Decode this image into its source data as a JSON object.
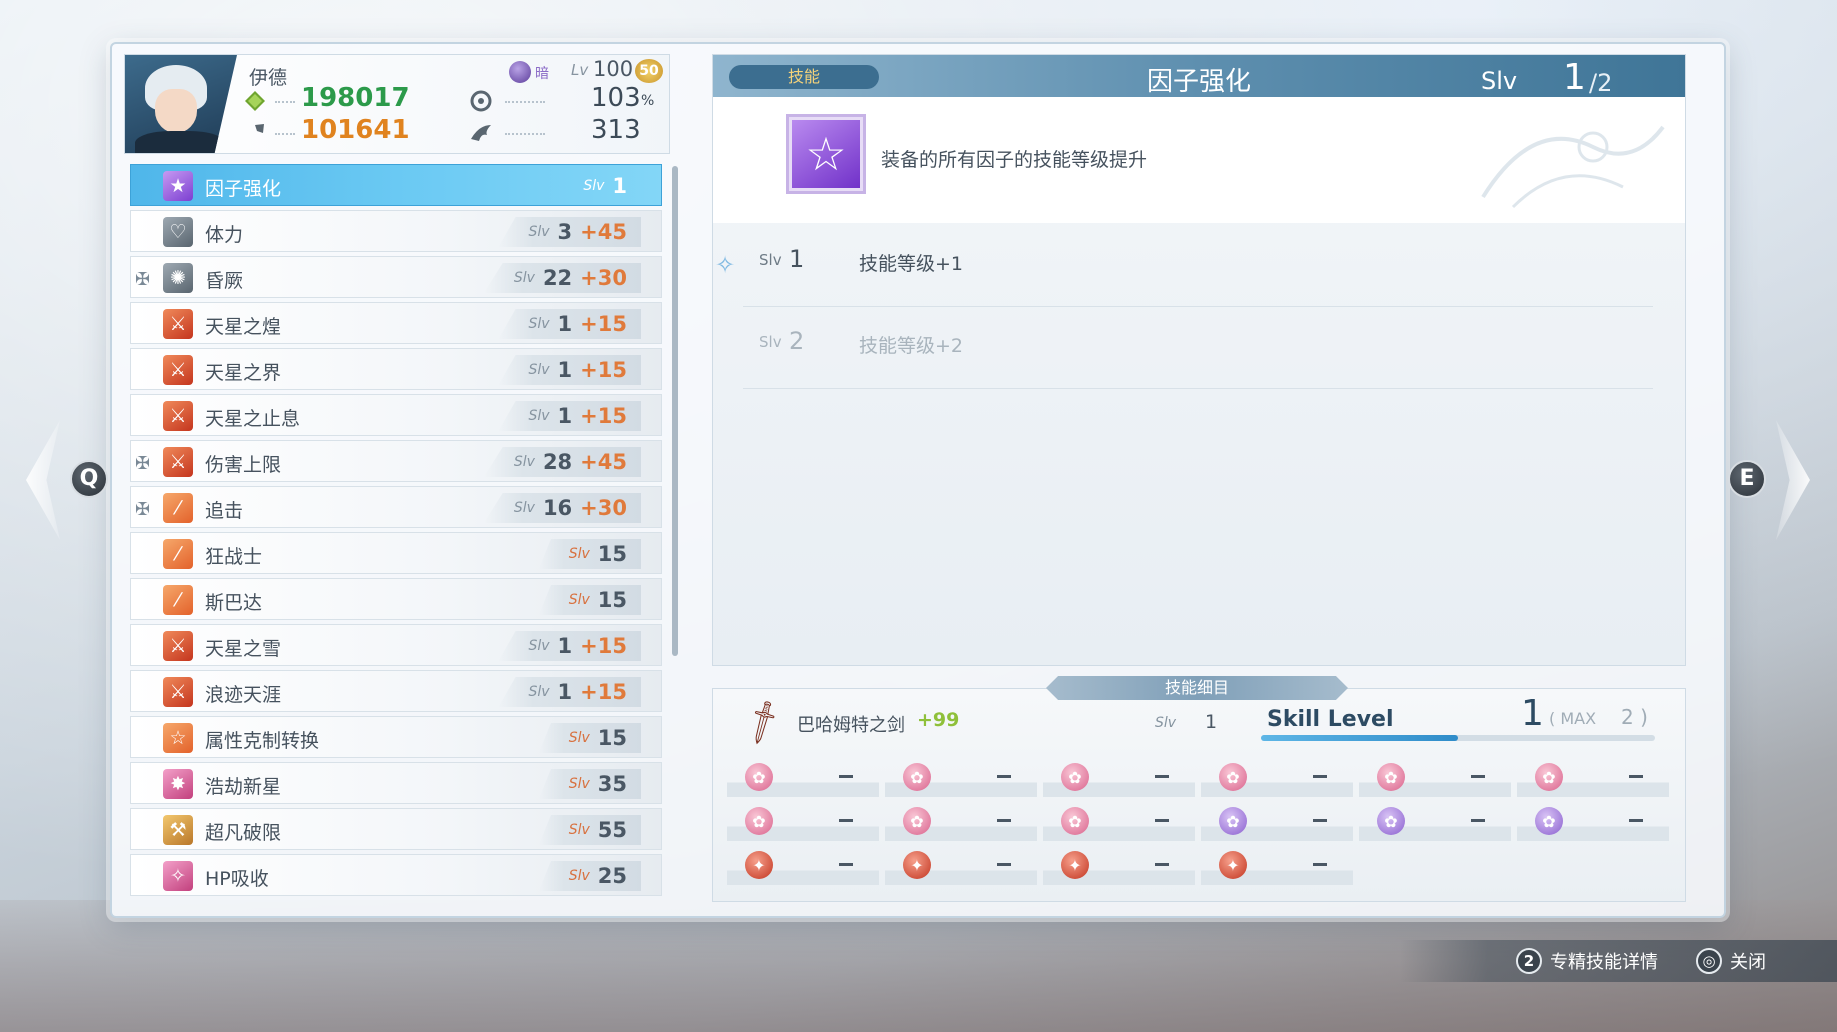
{
  "character": {
    "name": "伊德",
    "element_label": "暗",
    "level_label": "Lv",
    "level": "100",
    "limit_badge": "50",
    "hp": "198017",
    "attack": "101641",
    "crit_pct": "103",
    "crit_pct_unit": "%",
    "stat4": "313"
  },
  "skills": [
    {
      "name": "因子强化",
      "slv_label": "Slv",
      "level": "1",
      "bonus": "",
      "icon": "star-icon",
      "locked": false,
      "selected": true
    },
    {
      "name": "体力",
      "slv_label": "Slv",
      "level": "3",
      "bonus": "+45",
      "icon": "heart-icon",
      "locked": false,
      "selected": false
    },
    {
      "name": "昏厥",
      "slv_label": "Slv",
      "level": "22",
      "bonus": "+30",
      "icon": "stun-icon",
      "locked": true,
      "selected": false
    },
    {
      "name": "天星之煌",
      "slv_label": "Slv",
      "level": "1",
      "bonus": "+15",
      "icon": "sword-icon",
      "locked": false,
      "selected": false
    },
    {
      "name": "天星之界",
      "slv_label": "Slv",
      "level": "1",
      "bonus": "+15",
      "icon": "sword-icon",
      "locked": false,
      "selected": false
    },
    {
      "name": "天星之止息",
      "slv_label": "Slv",
      "level": "1",
      "bonus": "+15",
      "icon": "sword-icon",
      "locked": false,
      "selected": false
    },
    {
      "name": "伤害上限",
      "slv_label": "Slv",
      "level": "28",
      "bonus": "+45",
      "icon": "sword-icon",
      "locked": true,
      "selected": false
    },
    {
      "name": "追击",
      "slv_label": "Slv",
      "level": "16",
      "bonus": "+30",
      "icon": "blade-icon",
      "locked": true,
      "selected": false
    },
    {
      "name": "狂战士",
      "slv_label": "Slv",
      "level": "15",
      "bonus": "",
      "icon": "blade-icon",
      "locked": false,
      "selected": false
    },
    {
      "name": "斯巴达",
      "slv_label": "Slv",
      "level": "15",
      "bonus": "",
      "icon": "blade-icon",
      "locked": false,
      "selected": false
    },
    {
      "name": "天星之雪",
      "slv_label": "Slv",
      "level": "1",
      "bonus": "+15",
      "icon": "sword-icon",
      "locked": false,
      "selected": false
    },
    {
      "name": "浪迹天涯",
      "slv_label": "Slv",
      "level": "1",
      "bonus": "+15",
      "icon": "sword-icon",
      "locked": false,
      "selected": false
    },
    {
      "name": "属性克制转换",
      "slv_label": "Slv",
      "level": "15",
      "bonus": "",
      "icon": "star-outline-icon",
      "locked": false,
      "selected": false
    },
    {
      "name": "浩劫新星",
      "slv_label": "Slv",
      "level": "35",
      "bonus": "",
      "icon": "burst-icon",
      "locked": false,
      "selected": false
    },
    {
      "name": "超凡破限",
      "slv_label": "Slv",
      "level": "55",
      "bonus": "",
      "icon": "break-icon",
      "locked": false,
      "selected": false
    },
    {
      "name": "HP吸收",
      "slv_label": "Slv",
      "level": "25",
      "bonus": "",
      "icon": "drain-icon",
      "locked": false,
      "selected": false
    }
  ],
  "detail": {
    "tab": "技能",
    "title": "因子强化",
    "slv_label": "Slv",
    "slv_current": "1",
    "slv_max": "/2",
    "description": "装备的所有因子的技能等级提升",
    "levels": [
      {
        "label": "Slv",
        "num": "1",
        "text": "技能等级+1",
        "current": true
      },
      {
        "label": "Slv",
        "num": "2",
        "text": "技能等级+2",
        "current": false
      }
    ]
  },
  "sub_detail": {
    "title": "技能细目",
    "weapon_name": "巴哈姆特之剑",
    "weapon_plus": "+99",
    "slv_label": "Slv",
    "slv_value": "1",
    "skill_level_label": "Skill Level",
    "skill_level_current": "1",
    "max_label": "( MAX",
    "max_value": "2 )",
    "level_fraction": 0.5,
    "factors": [
      [
        "pink",
        "pink",
        "pink",
        "pink",
        "pink",
        "pink"
      ],
      [
        "pink",
        "pink",
        "pink",
        "violet",
        "violet",
        "violet"
      ],
      [
        "red",
        "red",
        "red",
        "red"
      ]
    ]
  },
  "nav": {
    "prev_key": "Q",
    "next_key": "E"
  },
  "footer": {
    "key1": "2",
    "action1": "专精技能详情",
    "key2": "◎",
    "action2": "关闭"
  },
  "colors": {
    "selected_row": "#5cbfee",
    "bonus": "#e07a3b",
    "hp": "#2c9a4a",
    "attack": "#e0831f"
  }
}
